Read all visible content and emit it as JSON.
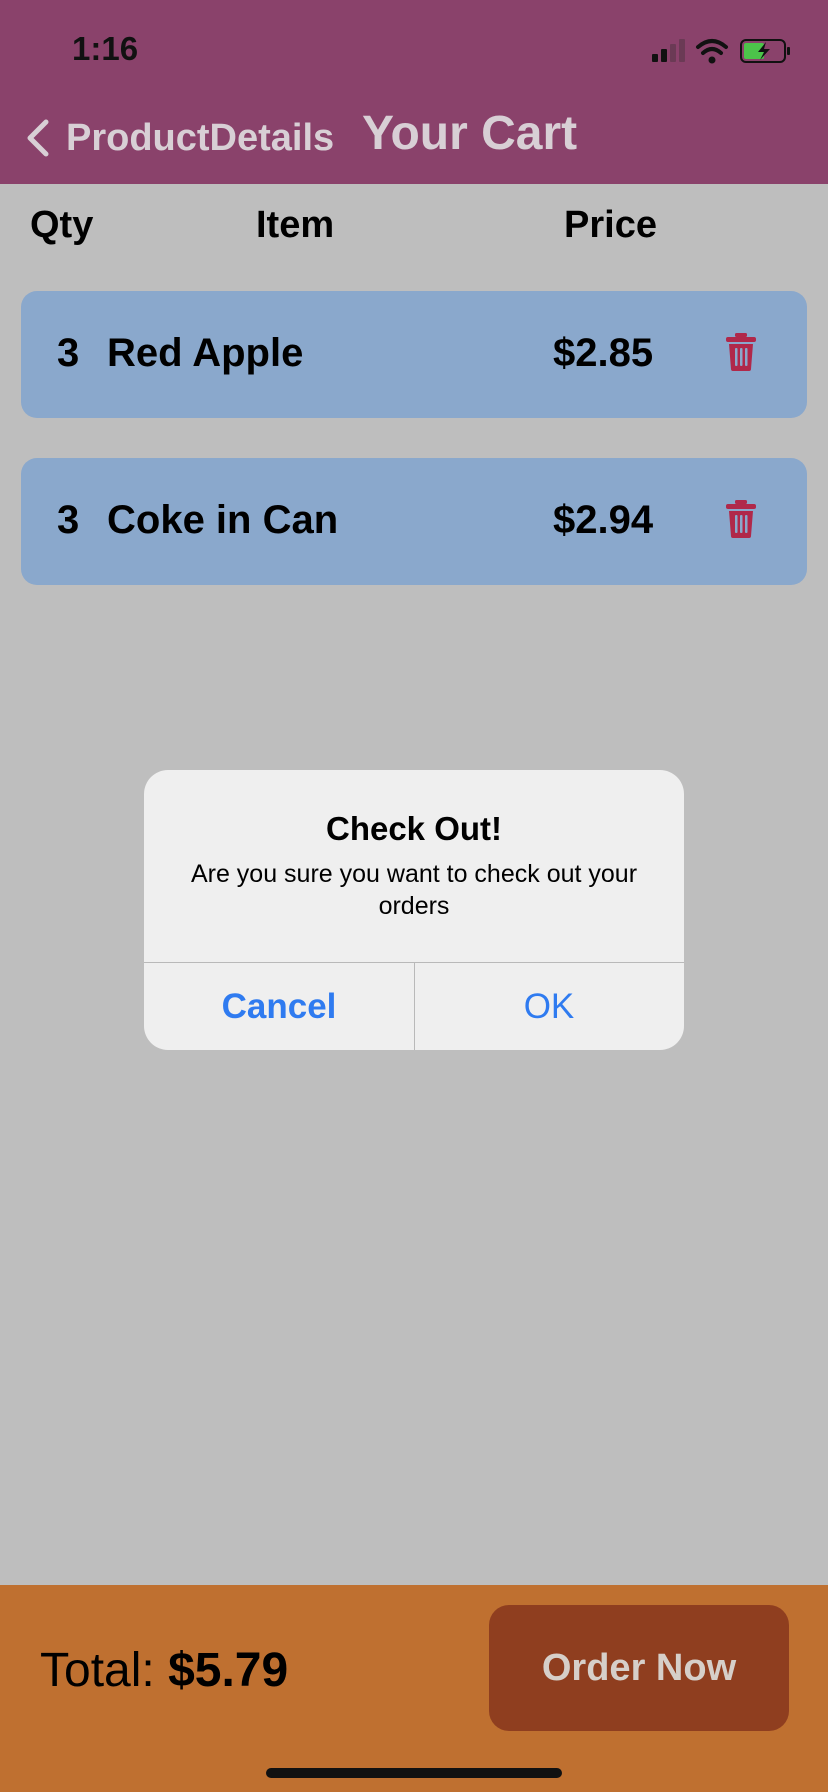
{
  "status_bar": {
    "time": "1:16",
    "icons": [
      "signal-icon",
      "wifi-icon",
      "battery-charging-icon"
    ]
  },
  "nav": {
    "back_label": "ProductDetails",
    "title": "Your Cart"
  },
  "columns": {
    "qty": "Qty",
    "item": "Item",
    "price": "Price"
  },
  "cart_items": [
    {
      "qty": "3",
      "name": "Red Apple",
      "price": "$2.85"
    },
    {
      "qty": "3",
      "name": "Coke in Can",
      "price": "$2.94"
    }
  ],
  "alert": {
    "title": "Check Out!",
    "message": "Are you sure you want to check out your orders",
    "cancel_label": "Cancel",
    "ok_label": "OK"
  },
  "footer": {
    "total_label": "Total:",
    "total_value": "$5.79",
    "order_button": "Order Now"
  },
  "colors": {
    "header": "#8a426b",
    "row": "#8aa8cc",
    "footer": "#bf7030",
    "order_button": "#8f3e1f",
    "alert_button": "#2f7bf0",
    "trash": "#b0284a"
  }
}
